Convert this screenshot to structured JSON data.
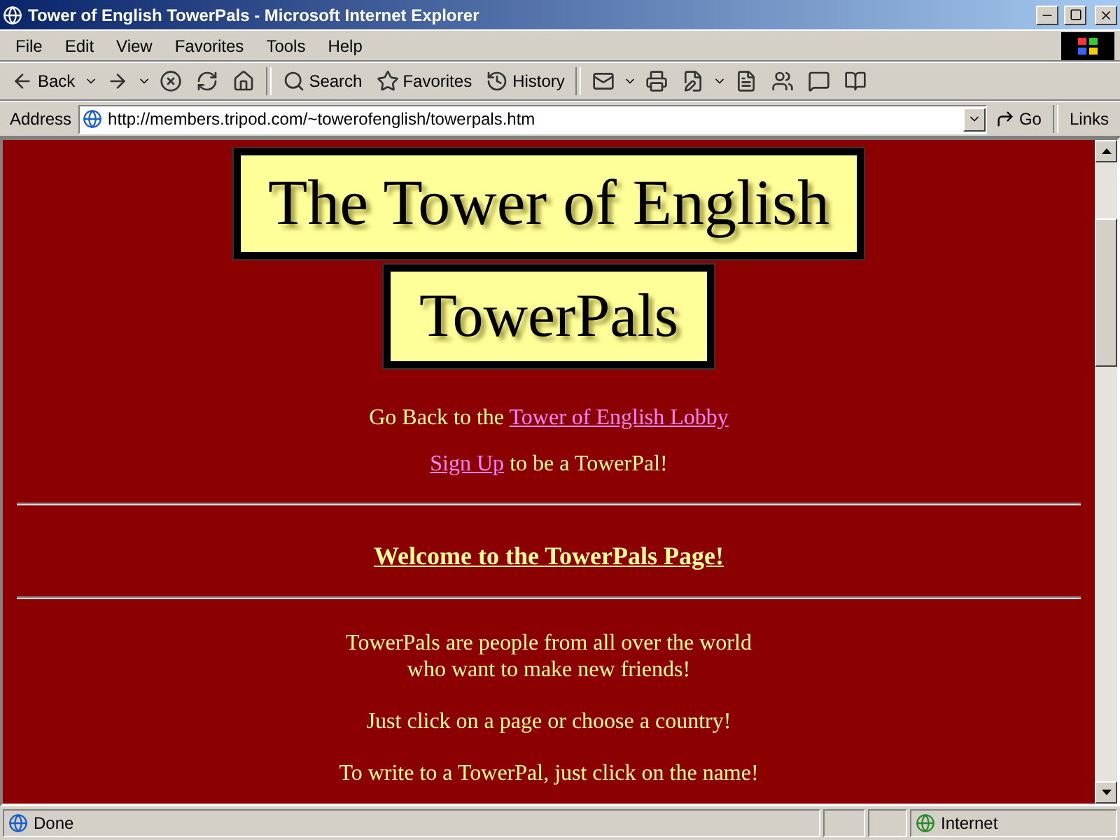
{
  "window": {
    "title": "Tower of English TowerPals - Microsoft Internet Explorer"
  },
  "menu": [
    "File",
    "Edit",
    "View",
    "Favorites",
    "Tools",
    "Help"
  ],
  "toolbar": [
    {
      "kind": "back",
      "label": "Back"
    },
    {
      "kind": "forward"
    },
    {
      "kind": "stop"
    },
    {
      "kind": "refresh"
    },
    {
      "kind": "home"
    },
    {
      "kind": "search",
      "label": "Search"
    },
    {
      "kind": "favorites",
      "label": "Favorites"
    },
    {
      "kind": "history",
      "label": "History"
    },
    {
      "kind": "mail"
    },
    {
      "kind": "print"
    },
    {
      "kind": "edit"
    },
    {
      "kind": "discuss"
    },
    {
      "kind": "messenger"
    },
    {
      "kind": "related"
    },
    {
      "kind": "research"
    }
  ],
  "address": {
    "label": "Address",
    "value": "http://members.tripod.com/~towerofenglish/towerpals.htm",
    "go": "Go",
    "links": "Links"
  },
  "page": {
    "banners": [
      "The Tower of English",
      "TowerPals"
    ],
    "intro": [
      [
        {
          "kind": "plain",
          "text": "Go Back to the "
        },
        {
          "kind": "link",
          "text": "Tower of English Lobby"
        }
      ],
      [
        {
          "kind": "link",
          "text": "Sign Up"
        },
        {
          "kind": "plain",
          "text": " to be a TowerPal!"
        }
      ]
    ],
    "heading": "Welcome to the TowerPals Page!",
    "paragraphs": [
      [
        "TowerPals are people from all over the world",
        "who want to make new friends!"
      ],
      [
        "Just click on a page or choose a country!"
      ],
      [
        "To write to a TowerPal, just click on the name!"
      ]
    ]
  },
  "status_bar": {
    "text": "Done",
    "zone": "Internet"
  }
}
